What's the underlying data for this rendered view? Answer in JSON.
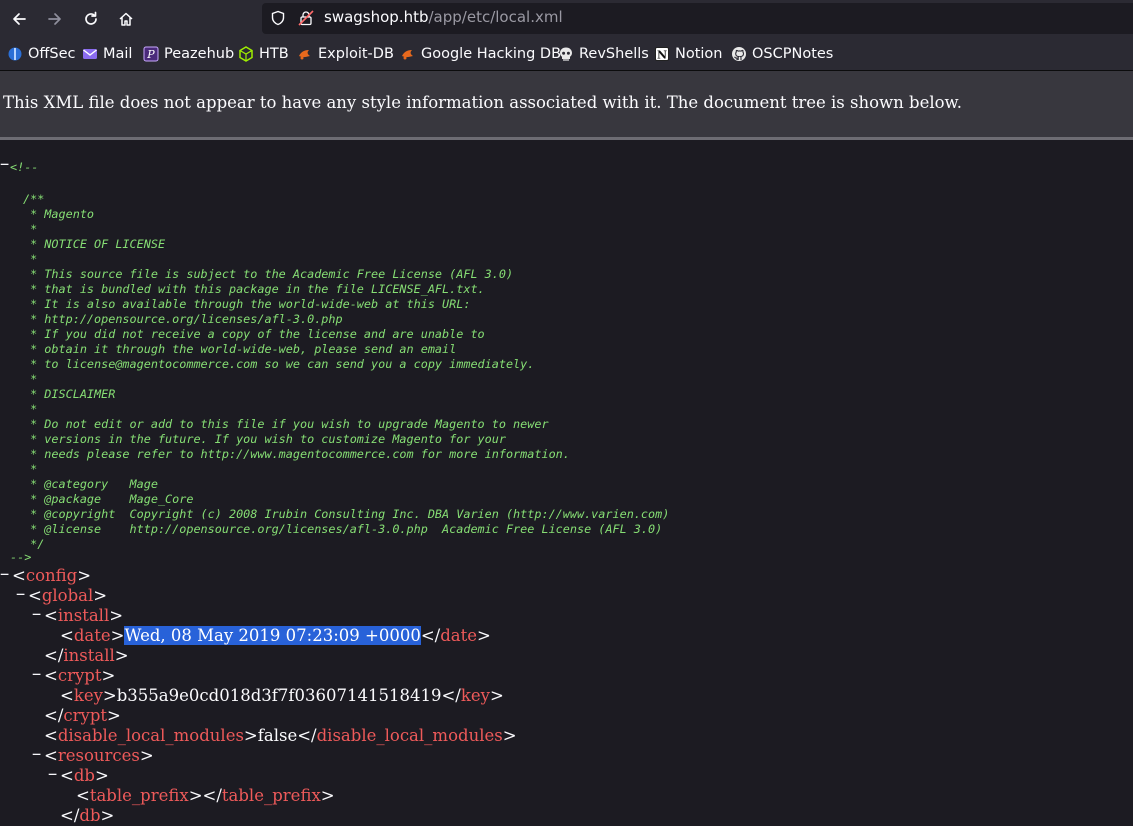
{
  "browser": {
    "url_host": "swagshop.htb",
    "url_path": "/app/etc/local.xml",
    "nav_icons": [
      "back-icon",
      "forward-icon",
      "reload-icon",
      "home-icon"
    ]
  },
  "bookmarks": [
    {
      "label": "OffSec",
      "icon": "offsec-icon"
    },
    {
      "label": "Mail",
      "icon": "mail-icon"
    },
    {
      "label": "Peazehub",
      "icon": "peazehub-icon"
    },
    {
      "label": "HTB",
      "icon": "htb-icon"
    },
    {
      "label": "Exploit-DB",
      "icon": "exploit-db-icon"
    },
    {
      "label": "Google Hacking DB",
      "icon": "ghdb-icon"
    },
    {
      "label": "RevShells",
      "icon": "skull-icon"
    },
    {
      "label": "Notion",
      "icon": "notion-icon"
    },
    {
      "label": "OSCPNotes",
      "icon": "github-icon"
    }
  ],
  "banner": {
    "message": "This XML file does not appear to have any style information associated with it. The document tree is shown below."
  },
  "xml": {
    "comment_open": "<!--",
    "comment_close": "-->",
    "comment_lines": [
      "/**",
      " * Magento",
      " *",
      " * NOTICE OF LICENSE",
      " *",
      " * This source file is subject to the Academic Free License (AFL 3.0)",
      " * that is bundled with this package in the file LICENSE_AFL.txt.",
      " * It is also available through the world-wide-web at this URL:",
      " * http://opensource.org/licenses/afl-3.0.php",
      " * If you did not receive a copy of the license and are unable to",
      " * obtain it through the world-wide-web, please send an email",
      " * to license@magentocommerce.com so we can send you a copy immediately.",
      " *",
      " * DISCLAIMER",
      " *",
      " * Do not edit or add to this file if you wish to upgrade Magento to newer",
      " * versions in the future. If you wish to customize Magento for your",
      " * needs please refer to http://www.magentocommerce.com for more information.",
      " *",
      " * @category   Mage",
      " * @package    Mage_Core",
      " * @copyright  Copyright (c) 2008 Irubin Consulting Inc. DBA Varien (http://www.varien.com)",
      " * @license    http://opensource.org/licenses/afl-3.0.php  Academic Free License (AFL 3.0)",
      " */"
    ],
    "tags": {
      "config": "config",
      "global": "global",
      "install": "install",
      "date": "date",
      "crypt": "crypt",
      "key": "key",
      "disable_local_modules": "disable_local_modules",
      "resources": "resources",
      "db": "db",
      "table_prefix": "table_prefix"
    },
    "values": {
      "date": "Wed, 08 May 2019 07:23:09 +0000",
      "key": "b355a9e0cd018d3f7f03607141518419",
      "disable_local_modules": "false",
      "table_prefix": ""
    },
    "collapse_symbol": "−"
  }
}
